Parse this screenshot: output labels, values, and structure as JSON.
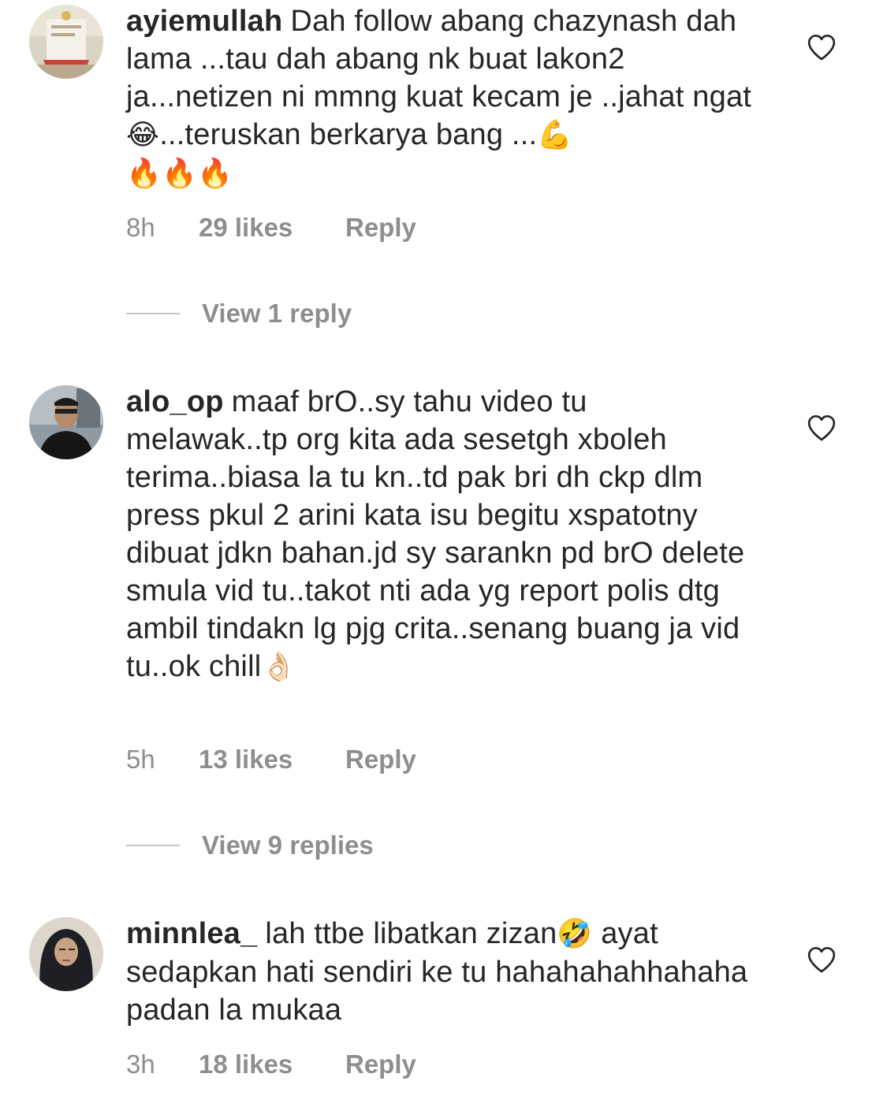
{
  "comments": [
    {
      "username": "ayiemullah",
      "text_parts": [
        "Dah follow abang chazynash dah lama ...tau dah abang nk buat lakon2 ja...netizen ni mmng kuat kecam je ..jahat ngat",
        "😂",
        "...teruskan berkarya bang ...",
        "💪",
        " 🔥🔥🔥"
      ],
      "time": "8h",
      "likes": "29 likes",
      "reply": "Reply",
      "view_replies": "View 1 reply"
    },
    {
      "username": "alo_op",
      "text_parts": [
        "maaf brO..sy tahu video tu melawak..tp org kita ada sesetgh xboleh terima..biasa la tu kn..td pak bri dh ckp dlm press pkul 2 arini kata isu begitu xspatotny dibuat jdkn bahan.jd sy sarankn pd brO delete smula vid tu..takot nti ada yg report polis dtg ambil tindakn lg pjg crita..senang buang ja vid tu..ok chill",
        "👌🏻"
      ],
      "time": "5h",
      "likes": "13 likes",
      "reply": "Reply",
      "view_replies": "View 9 replies"
    },
    {
      "username": "minnlea_",
      "text_parts": [
        "lah ttbe libatkan zizan",
        "🤣",
        " ayat sedapkan hati sendiri ke tu hahahahahhahaha padan la mukaa"
      ],
      "time": "3h",
      "likes": "18 likes",
      "reply": "Reply"
    }
  ]
}
